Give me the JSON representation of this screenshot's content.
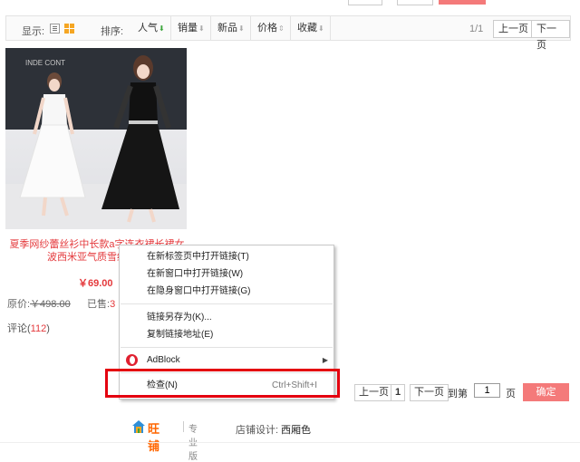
{
  "toolbar": {
    "display_label": "显示:",
    "sort_label": "排序:",
    "sort_items": [
      {
        "label": "人气",
        "arrow": "⬇",
        "arrow_color": "#3aa53a"
      },
      {
        "label": "销量",
        "arrow": "⬇",
        "arrow_color": "#aaaaaa"
      },
      {
        "label": "新品",
        "arrow": "⬇",
        "arrow_color": "#aaaaaa"
      },
      {
        "label": "价格",
        "arrow": "⇕",
        "arrow_color": "#aaaaaa"
      },
      {
        "label": "收藏",
        "arrow": "⬇",
        "arrow_color": "#aaaaaa"
      }
    ],
    "page_count": "1/1",
    "prev_label": "上一页",
    "next_label": "下一页"
  },
  "product": {
    "title": "夏季网纱蕾丝衫中长款a字连衣裙长裙女波西米亚气质雪纺沙滩",
    "price": "￥69.00",
    "orig_label": "原价:",
    "orig_price": "￥498.00",
    "sold_label": "已售:",
    "sold_value": "3",
    "comment_label": "评论(",
    "comment_count": "112",
    "comment_close": ")",
    "image_wall_text": "INDE CONT"
  },
  "context_menu": {
    "items": [
      {
        "label": "在新标签页中打开链接(T)"
      },
      {
        "label": "在新窗口中打开链接(W)"
      },
      {
        "label": "在隐身窗口中打开链接(G)"
      },
      {
        "label": "链接另存为(K)..."
      },
      {
        "label": "复制链接地址(E)"
      },
      {
        "label": "AdBlock",
        "icon": "opera-icon",
        "submenu_arrow": "▶"
      },
      {
        "label": "检查(N)",
        "shortcut": "Ctrl+Shift+I"
      }
    ],
    "highlight_color": "#e4000f"
  },
  "pagination": {
    "prev": "上一页",
    "current": "1",
    "next": "下一页",
    "goto_label": "到第",
    "page_input": "1",
    "page_unit": "页",
    "confirm": "确定"
  },
  "footer": {
    "brand": "旺铺",
    "edition": "专业版",
    "design_label": "店铺设计:",
    "designer": "西厢色"
  },
  "colors": {
    "accent_red": "#e4393c",
    "button_pink": "#f47a7a",
    "brand_orange": "#ff6600",
    "grid_icon": "#f5a623"
  }
}
